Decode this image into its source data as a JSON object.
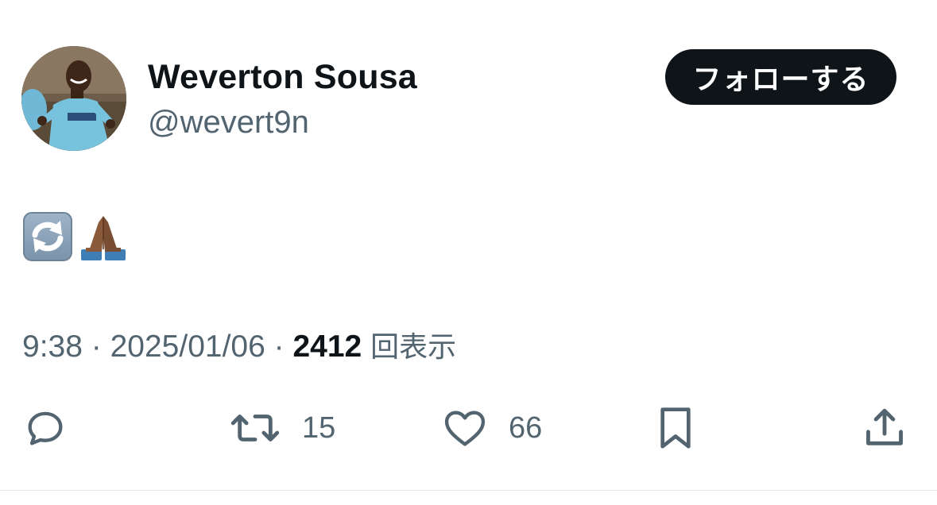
{
  "author": {
    "display_name": "Weverton Sousa",
    "handle": "@wevert9n"
  },
  "follow_button": {
    "label": "フォローする"
  },
  "tweet": {
    "emojis": [
      "counterclockwise-arrows-button",
      "folded-hands-medium-dark-skin-tone"
    ]
  },
  "meta": {
    "time": "9:38",
    "separator": "·",
    "date": "2025/01/06",
    "views_count": "2412",
    "views_label": "回表示"
  },
  "actions": {
    "reply": {
      "icon": "reply-icon"
    },
    "retweet": {
      "icon": "retweet-icon",
      "count": "15"
    },
    "like": {
      "icon": "heart-icon",
      "count": "66"
    },
    "bookmark": {
      "icon": "bookmark-icon"
    },
    "share": {
      "icon": "share-icon"
    }
  },
  "colors": {
    "text_primary": "#0f1419",
    "text_secondary": "#536471",
    "button_bg": "#0f1419",
    "button_text": "#ffffff"
  }
}
